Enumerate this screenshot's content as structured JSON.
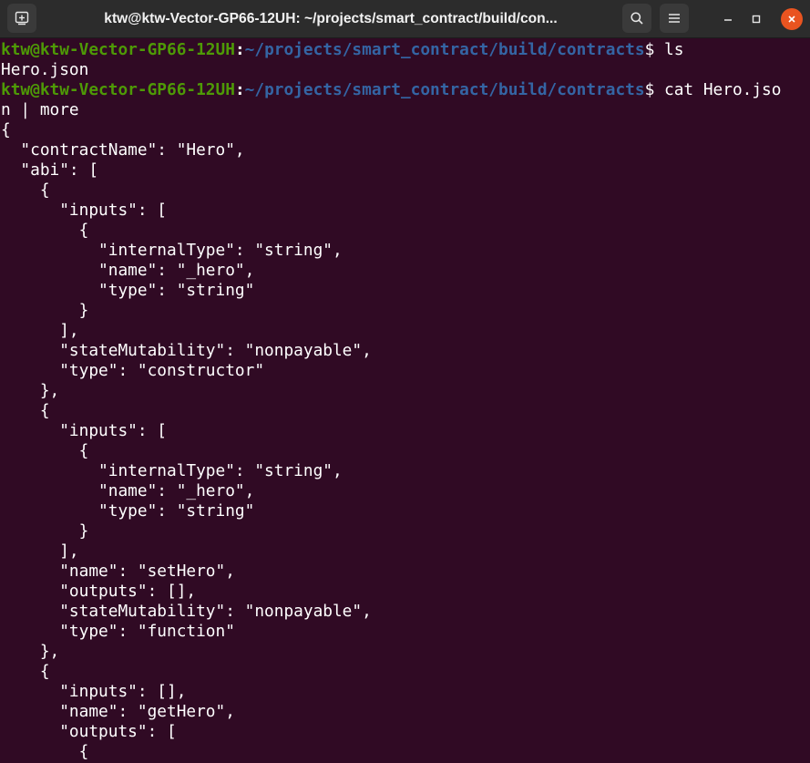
{
  "window": {
    "title": "ktw@ktw-Vector-GP66-12UH: ~/projects/smart_contract/build/con...",
    "icons": {
      "new_tab": "new-tab-icon",
      "search": "search-icon",
      "menu": "hamburger-menu-icon",
      "minimize": "minimize-icon",
      "maximize": "maximize-icon",
      "close": "close-icon"
    }
  },
  "colors": {
    "terminal_background": "#300a24",
    "prompt_user": "#4e9a06",
    "prompt_path": "#3465a4",
    "text": "#ffffff",
    "close_button": "#e95420"
  },
  "terminal": {
    "prompt": {
      "user_host": "ktw@ktw-Vector-GP66-12UH",
      "colon": ":",
      "path": "~/projects/smart_contract/build/contracts",
      "dollar": "$"
    },
    "commands": [
      {
        "command": " ls"
      },
      {
        "command": " cat Hero.jso"
      }
    ],
    "output_lines": [
      "Hero.json",
      "n | more",
      "{",
      "  \"contractName\": \"Hero\",",
      "  \"abi\": [",
      "    {",
      "      \"inputs\": [",
      "        {",
      "          \"internalType\": \"string\",",
      "          \"name\": \"_hero\",",
      "          \"type\": \"string\"",
      "        }",
      "      ],",
      "      \"stateMutability\": \"nonpayable\",",
      "      \"type\": \"constructor\"",
      "    },",
      "    {",
      "      \"inputs\": [",
      "        {",
      "          \"internalType\": \"string\",",
      "          \"name\": \"_hero\",",
      "          \"type\": \"string\"",
      "        }",
      "      ],",
      "      \"name\": \"setHero\",",
      "      \"outputs\": [],",
      "      \"stateMutability\": \"nonpayable\",",
      "      \"type\": \"function\"",
      "    },",
      "    {",
      "      \"inputs\": [],",
      "      \"name\": \"getHero\",",
      "      \"outputs\": [",
      "        {"
    ]
  }
}
